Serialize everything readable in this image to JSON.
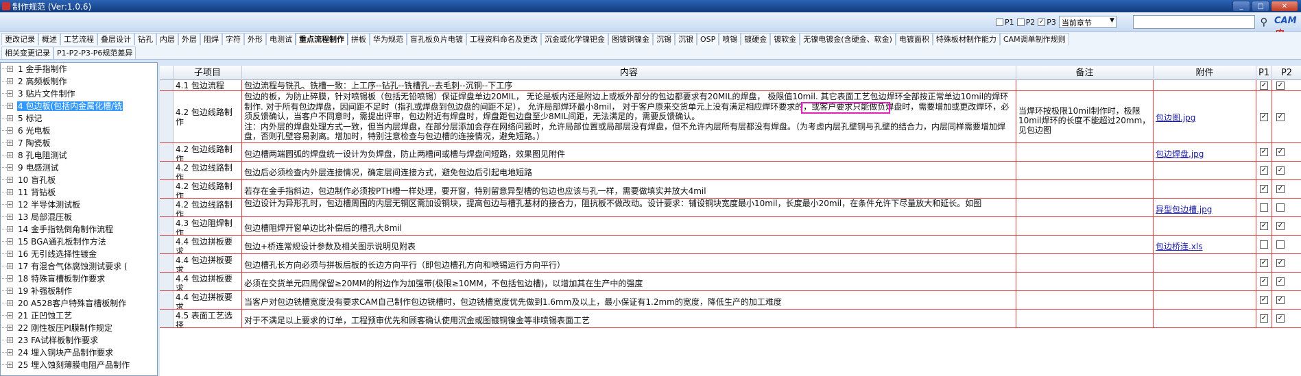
{
  "window": {
    "title": "制作规范 (Ver:1.0.6)",
    "min": "_",
    "max": "□",
    "close": "✕"
  },
  "topbar": {
    "filters": [
      {
        "label": "P1",
        "checked": false
      },
      {
        "label": "P2",
        "checked": false
      },
      {
        "label": "P3",
        "checked": true
      }
    ],
    "chapter_select": "当前章节",
    "search_value": "",
    "search_icon": "search-icon",
    "logo_a": "CAM",
    "logo_b": "中"
  },
  "tabs_row1": [
    "更改记录",
    "概述",
    "工艺流程",
    "叠层设计",
    "钻孔",
    "内层",
    "外层",
    "阻焊",
    "字符",
    "外形",
    "电测试",
    "重点流程制作",
    "拼板",
    "华为规范",
    "盲孔板负片电镀",
    "工程资料命名及更改",
    "沉金或化学镍钯金",
    "图镀铜镍金",
    "沉锡",
    "沉银",
    "OSP",
    "喷锡",
    "镀硬金",
    "镀软金",
    "无镍电镀金(含硬金、软金)",
    "电镀面积",
    "特殊板材制作能力",
    "CAM调单制作规则"
  ],
  "tabs_row2": [
    "相关变更记录",
    "P1-P2-P3-P6规范差异"
  ],
  "active_tab": "重点流程制作",
  "sidebar": {
    "items": [
      "1 金手指制作",
      "2 高频板制作",
      "3 贴片文件制作",
      "4 包边板(包括内金属化槽/铣",
      "5 标记",
      "6 光电板",
      "7 陶瓷板",
      "8 孔电阻测试",
      "9 电感测试",
      "10 盲孔板",
      "11 背钻板",
      "12 半导体测试板",
      "13 局部混压板",
      "14 金手指铣倒角制作流程",
      "15 BGA通孔板制作方法",
      "16 无引线选择性镀金",
      "17 有混合气体腐蚀测试要求 (",
      "18 特殊盲槽板制作要求",
      "19 补强板制作",
      "20 A528客户特殊盲槽板制作",
      "21 正凹蚀工艺",
      "22 刚性板压PI膜制作规定",
      "23 FA试样板制作要求",
      "24 埋入铜块产品制作要求",
      "25 埋入蚀刻薄膜电阻产品制作"
    ],
    "selected_index": 3
  },
  "grid": {
    "headers": {
      "item": "子项目",
      "content": "内容",
      "note": "备注",
      "attach": "附件",
      "p1": "P1",
      "p2": "P2"
    },
    "rows": [
      {
        "item": "4.1 包边流程",
        "content": "包边流程与铣孔、铣槽一致：上工序--钻孔--铣槽孔--去毛刺--沉铜--下工序",
        "note": "",
        "attach": "",
        "p1": true,
        "p2": true
      },
      {
        "item": "4.2 包边线路制作",
        "content": "包边的板，为防止碎膜，针对喷锡板（包括无铅喷锡）保证焊盘单边20MIL， 无论是板内还是附边上或板外部分的包边都要求有20MIL的焊盘， 极限值10mil. 其它表面工艺包边焊环全部按正常单边10mil的焊环制作. 对于所有包边焊盘，因间距不足时（指孔或焊盘到包边盘的间距不足）， 允许局部焊环最小8mil， 对于客户原来交货单元上没有满足相应焊环要求的，或客户要求只能做负焊盘时，需要增加或更改焊环，必须反馈确认，当客户不同意时，需提出评审，包边附近有焊盘时，焊盘距包边盘至少8MIL间距，无法满足的，需要反馈确认。\n注：内外层的焊盘处理方式一致，但当内层焊盘，在部分层添加会存在网络问题时，允许局部位置或局部层没有焊盘，但不允许内层所有层都没有焊盘。（为考虑内层孔壁铜与孔壁的结合力，内层同样需要增加焊盘，否则孔壁容易剥离。增加时，特别注意检查与包边槽的连接情况，避免短路。）",
        "note": "当焊环按极限10mil制作时，极限10mil焊环的长度不能超过20mm，见包边图",
        "attach": "包边图.jpg",
        "p1": true,
        "p2": true
      },
      {
        "item": "4.2 包边线路制作",
        "content": "包边槽两端圆弧的焊盘统一设计为负焊盘，防止两槽间或槽与焊盘间短路，效果图见附件",
        "note": "",
        "attach": "包边焊盘.jpg",
        "p1": true,
        "p2": true
      },
      {
        "item": "4.2 包边线路制作",
        "content": "包边后必须检查内外层连接情况，确定层间连接方式，避免包边后引起电地短路",
        "note": "",
        "attach": "",
        "p1": true,
        "p2": true
      },
      {
        "item": "4.2 包边线路制作",
        "content": "若存在金手指斜边，包边制作必须按PTH槽一样处理，要开窗，特别留意异型槽的包边也应该与孔一样，需要做填实并放大4mil",
        "note": "",
        "attach": "",
        "p1": true,
        "p2": true
      },
      {
        "item": "4.2 包边线路制作",
        "content": "包边设计为异形孔时，包边槽周围的内层无铜区需加设铜块，提高包边与槽孔基材的接合力，阻抗板不做改动。设计要求：铺设铜块宽度最小10mil，长度最小20mil，在条件允许下尽量放大和延长。如图",
        "note": "",
        "attach": "异型包边槽.jpg",
        "p1": false,
        "p2": false
      },
      {
        "item": "4.3 包边阻焊制作",
        "content": "包边槽阻焊开窗单边比补偿后的槽孔大8mil",
        "note": "",
        "attach": "",
        "p1": true,
        "p2": true
      },
      {
        "item": "4.4 包边拼板要求",
        "content": "包边+桥连常规设计参数及相关图示说明见附表",
        "note": "",
        "attach": "包边桥连.xls",
        "p1": false,
        "p2": false
      },
      {
        "item": "4.4 包边拼板要求",
        "content": "包边槽孔长方向必须与拼板后板的长边方向平行（即包边槽孔方向和喷锡运行方向平行）",
        "note": "",
        "attach": "",
        "p1": true,
        "p2": true
      },
      {
        "item": "4.4 包边拼板要求",
        "content": "必须在交货单元四周保留≥20MM的附边作为加强带(极限≥10MM，不包括包边槽)，以增加其在生产中的强度",
        "note": "",
        "attach": "",
        "p1": true,
        "p2": true
      },
      {
        "item": "4.4 包边拼板要求",
        "content": "当客户对包边铣槽宽度没有要求CAM自己制作包边铣槽时，包边铣槽宽度优先做到1.6mm及以上，最小保证有1.2mm的宽度，降低生产的加工难度",
        "note": "",
        "attach": "",
        "p1": true,
        "p2": true
      },
      {
        "item": "4.5 表面工艺选择",
        "content": "对于不满足以上要求的订单，工程预审优先和顾客确认使用沉金或图镀铜镍金等非喷锡表面工艺",
        "note": "",
        "attach": "",
        "p1": true,
        "p2": true
      }
    ]
  }
}
